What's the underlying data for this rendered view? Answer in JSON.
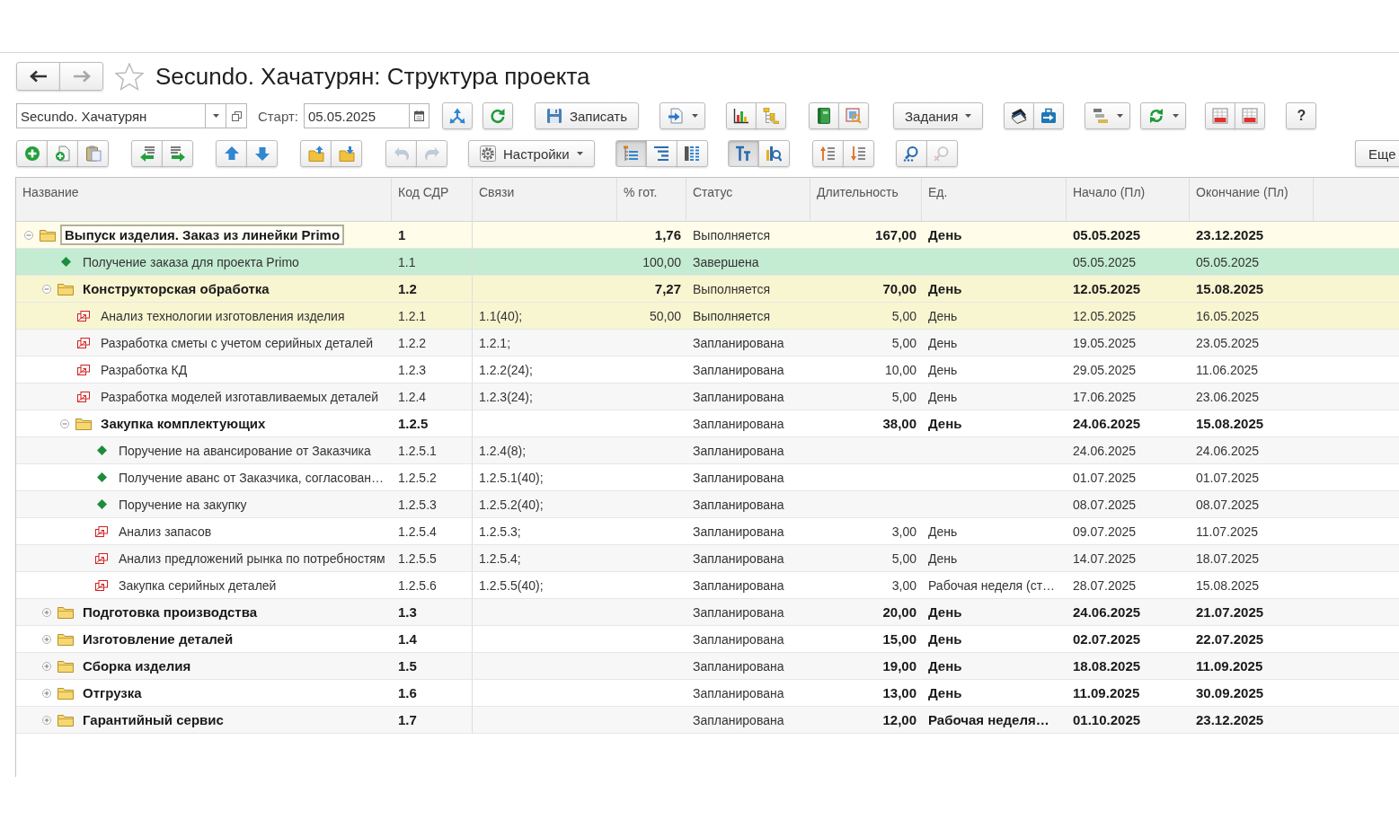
{
  "title_bar": {
    "back_button": {
      "disabled": false
    },
    "forward_button": {
      "disabled": true
    },
    "favorite": {
      "on": false
    },
    "title": "Secundo. Хачатурян: Структура проекта"
  },
  "toolbar_1": {
    "project_field": {
      "value": "Secundo. Хачатурян"
    },
    "start_label": "Старт:",
    "start_field": {
      "value": "05.05.2025"
    },
    "groups": [
      {
        "buttons": [
          {
            "kind": "icon",
            "menu": false
          }
        ]
      },
      {
        "buttons": [
          {
            "kind": "icon",
            "menu": false
          }
        ]
      },
      {
        "buttons": [
          {
            "kind": "icon_label",
            "label": "Записать",
            "menu": false
          }
        ]
      },
      {
        "buttons": [
          {
            "kind": "icon",
            "menu": true
          }
        ]
      },
      {
        "buttons": [
          {
            "kind": "icon",
            "menu": false
          },
          {
            "kind": "icon",
            "menu": false
          }
        ]
      },
      {
        "buttons": [
          {
            "kind": "icon",
            "menu": false
          },
          {
            "kind": "icon",
            "menu": false
          }
        ]
      },
      {
        "buttons": [
          {
            "kind": "label",
            "label": "Задания",
            "menu": true
          }
        ]
      },
      {
        "buttons": [
          {
            "kind": "icon",
            "menu": false
          },
          {
            "kind": "icon",
            "menu": false
          }
        ]
      },
      {
        "buttons": [
          {
            "kind": "icon",
            "menu": true
          }
        ]
      },
      {
        "buttons": [
          {
            "kind": "icon",
            "menu": true
          }
        ]
      },
      {
        "buttons": [
          {
            "kind": "icon",
            "menu": false
          },
          {
            "kind": "icon",
            "menu": false
          }
        ]
      },
      {
        "buttons": [
          {
            "kind": "label",
            "label": "?",
            "menu": false
          }
        ]
      }
    ]
  },
  "toolbar_2": {
    "groups": [
      {
        "buttons": [
          {
            "kind": "icon",
            "menu": false,
            "pressed": false,
            "disabled": false
          },
          {
            "kind": "icon",
            "menu": false,
            "pressed": false,
            "disabled": false
          },
          {
            "kind": "icon",
            "menu": false,
            "pressed": false,
            "disabled": false
          }
        ]
      },
      {
        "buttons": [
          {
            "kind": "icon",
            "menu": false,
            "pressed": false,
            "disabled": false
          },
          {
            "kind": "icon",
            "menu": false,
            "pressed": false,
            "disabled": false
          }
        ]
      },
      {
        "buttons": [
          {
            "kind": "icon",
            "menu": false,
            "pressed": false,
            "disabled": false
          },
          {
            "kind": "icon",
            "menu": false,
            "pressed": false,
            "disabled": false
          }
        ]
      },
      {
        "buttons": [
          {
            "kind": "icon",
            "menu": false,
            "pressed": false,
            "disabled": false
          },
          {
            "kind": "icon",
            "menu": false,
            "pressed": false,
            "disabled": false
          }
        ]
      },
      {
        "buttons": [
          {
            "kind": "icon",
            "menu": false,
            "pressed": false,
            "disabled": true
          },
          {
            "kind": "icon",
            "menu": false,
            "pressed": false,
            "disabled": true
          }
        ]
      },
      {
        "buttons": [
          {
            "kind": "icon_label",
            "label": "Настройки",
            "menu": true,
            "pressed": false,
            "disabled": false
          }
        ]
      },
      {
        "buttons": [
          {
            "kind": "icon",
            "menu": false,
            "pressed": true,
            "disabled": false
          },
          {
            "kind": "icon",
            "menu": false,
            "pressed": false,
            "disabled": false
          },
          {
            "kind": "icon",
            "menu": false,
            "pressed": false,
            "disabled": false
          }
        ]
      },
      {
        "buttons": [
          {
            "kind": "icon",
            "menu": false,
            "pressed": true,
            "disabled": false
          },
          {
            "kind": "icon",
            "menu": false,
            "pressed": false,
            "disabled": false
          }
        ]
      },
      {
        "buttons": [
          {
            "kind": "icon",
            "menu": false,
            "pressed": false,
            "disabled": false
          },
          {
            "kind": "icon",
            "menu": false,
            "pressed": false,
            "disabled": false
          }
        ]
      },
      {
        "buttons": [
          {
            "kind": "icon",
            "menu": false,
            "pressed": false,
            "disabled": false
          },
          {
            "kind": "icon",
            "menu": false,
            "pressed": false,
            "disabled": true
          }
        ]
      }
    ],
    "more_button": {
      "label": "Еще"
    }
  },
  "table": {
    "columns": [
      {
        "label": "Название"
      },
      {
        "label": "Код СДР"
      },
      {
        "label": "Связи"
      },
      {
        "label": "% гот."
      },
      {
        "label": "Статус"
      },
      {
        "label": "Длительность"
      },
      {
        "label": "Ед."
      },
      {
        "label": "Начало (Пл)"
      },
      {
        "label": "Окончание (Пл)"
      }
    ],
    "rows": [
      {
        "kind": "group",
        "expanded": true,
        "selected": true,
        "in_progress": true,
        "completed": false,
        "name": "Выпуск изделия. Заказ из линейки Primo",
        "wbs_code": "1",
        "percent_done": "1,76",
        "status": "Выполняется",
        "duration": "167,00",
        "unit": "День",
        "start": "05.05.2025",
        "end": "23.12.2025",
        "children": [
          {
            "kind": "milestone",
            "selected": false,
            "in_progress": false,
            "completed": true,
            "name": "Получение заказа для проекта Primo",
            "wbs_code": "1.1",
            "percent_done": "100,00",
            "status": "Завершена",
            "start": "05.05.2025",
            "end": "05.05.2025"
          },
          {
            "kind": "group",
            "expanded": true,
            "selected": false,
            "in_progress": true,
            "completed": false,
            "name": "Конструкторская обработка",
            "wbs_code": "1.2",
            "percent_done": "7,27",
            "status": "Выполняется",
            "duration": "70,00",
            "unit": "День",
            "start": "12.05.2025",
            "end": "15.08.2025",
            "children": [
              {
                "kind": "task",
                "selected": false,
                "in_progress": true,
                "completed": false,
                "name": "Анализ технологии изготовления изделия",
                "wbs_code": "1.2.1",
                "links": "1.1(40);",
                "percent_done": "50,00",
                "status": "Выполняется",
                "duration": "5,00",
                "unit": "День",
                "start": "12.05.2025",
                "end": "16.05.2025"
              },
              {
                "kind": "task",
                "selected": false,
                "in_progress": false,
                "completed": false,
                "name": "Разработка сметы с учетом серийных деталей",
                "wbs_code": "1.2.2",
                "links": "1.2.1;",
                "status": "Запланирована",
                "duration": "5,00",
                "unit": "День",
                "start": "19.05.2025",
                "end": "23.05.2025"
              },
              {
                "kind": "task",
                "selected": false,
                "in_progress": false,
                "completed": false,
                "name": "Разработка КД",
                "wbs_code": "1.2.3",
                "links": "1.2.2(24);",
                "status": "Запланирована",
                "duration": "10,00",
                "unit": "День",
                "start": "29.05.2025",
                "end": "11.06.2025"
              },
              {
                "kind": "task",
                "selected": false,
                "in_progress": false,
                "completed": false,
                "name": "Разработка моделей изготавливаемых деталей",
                "wbs_code": "1.2.4",
                "links": "1.2.3(24);",
                "status": "Запланирована",
                "duration": "5,00",
                "unit": "День",
                "start": "17.06.2025",
                "end": "23.06.2025"
              },
              {
                "kind": "group",
                "expanded": true,
                "selected": false,
                "in_progress": false,
                "completed": false,
                "name": "Закупка комплектующих",
                "wbs_code": "1.2.5",
                "status": "Запланирована",
                "duration": "38,00",
                "unit": "День",
                "start": "24.06.2025",
                "end": "15.08.2025",
                "children": [
                  {
                    "kind": "milestone",
                    "selected": false,
                    "in_progress": false,
                    "completed": false,
                    "name": "Поручение на авансирование от Заказчика",
                    "wbs_code": "1.2.5.1",
                    "links": "1.2.4(8);",
                    "status": "Запланирована",
                    "start": "24.06.2025",
                    "end": "24.06.2025"
                  },
                  {
                    "kind": "milestone",
                    "selected": false,
                    "in_progress": false,
                    "completed": false,
                    "name": "Получение аванс от Заказчика, согласован…",
                    "wbs_code": "1.2.5.2",
                    "links": "1.2.5.1(40);",
                    "status": "Запланирована",
                    "start": "01.07.2025",
                    "end": "01.07.2025"
                  },
                  {
                    "kind": "milestone",
                    "selected": false,
                    "in_progress": false,
                    "completed": false,
                    "name": "Поручение на закупку",
                    "wbs_code": "1.2.5.3",
                    "links": "1.2.5.2(40);",
                    "status": "Запланирована",
                    "start": "08.07.2025",
                    "end": "08.07.2025"
                  },
                  {
                    "kind": "task",
                    "selected": false,
                    "in_progress": false,
                    "completed": false,
                    "name": "Анализ запасов",
                    "wbs_code": "1.2.5.4",
                    "links": "1.2.5.3;",
                    "status": "Запланирована",
                    "duration": "3,00",
                    "unit": "День",
                    "start": "09.07.2025",
                    "end": "11.07.2025"
                  },
                  {
                    "kind": "task",
                    "selected": false,
                    "in_progress": false,
                    "completed": false,
                    "name": "Анализ предложений рынка по потребностям",
                    "wbs_code": "1.2.5.5",
                    "links": "1.2.5.4;",
                    "status": "Запланирована",
                    "duration": "5,00",
                    "unit": "День",
                    "start": "14.07.2025",
                    "end": "18.07.2025"
                  },
                  {
                    "kind": "task",
                    "selected": false,
                    "in_progress": false,
                    "completed": false,
                    "name": "Закупка серийных деталей",
                    "wbs_code": "1.2.5.6",
                    "links": "1.2.5.5(40);",
                    "status": "Запланирована",
                    "duration": "3,00",
                    "unit": "Рабочая неделя (ст…",
                    "start": "28.07.2025",
                    "end": "15.08.2025"
                  }
                ]
              }
            ]
          },
          {
            "kind": "group",
            "expanded": false,
            "selected": false,
            "in_progress": false,
            "completed": false,
            "name": "Подготовка производства",
            "wbs_code": "1.3",
            "status": "Запланирована",
            "duration": "20,00",
            "unit": "День",
            "start": "24.06.2025",
            "end": "21.07.2025"
          },
          {
            "kind": "group",
            "expanded": false,
            "selected": false,
            "in_progress": false,
            "completed": false,
            "name": "Изготовление деталей",
            "wbs_code": "1.4",
            "status": "Запланирована",
            "duration": "15,00",
            "unit": "День",
            "start": "02.07.2025",
            "end": "22.07.2025"
          },
          {
            "kind": "group",
            "expanded": false,
            "selected": false,
            "in_progress": false,
            "completed": false,
            "name": "Сборка изделия",
            "wbs_code": "1.5",
            "status": "Запланирована",
            "duration": "19,00",
            "unit": "День",
            "start": "18.08.2025",
            "end": "11.09.2025"
          },
          {
            "kind": "group",
            "expanded": false,
            "selected": false,
            "in_progress": false,
            "completed": false,
            "name": "Отгрузка",
            "wbs_code": "1.6",
            "status": "Запланирована",
            "duration": "13,00",
            "unit": "День",
            "start": "11.09.2025",
            "end": "30.09.2025"
          },
          {
            "kind": "group",
            "expanded": false,
            "selected": false,
            "in_progress": false,
            "completed": false,
            "name": "Гарантийный сервис",
            "wbs_code": "1.7",
            "status": "Запланирована",
            "duration": "12,00",
            "unit": "Рабочая неделя…",
            "start": "01.10.2025",
            "end": "23.12.2025"
          }
        ]
      }
    ]
  }
}
